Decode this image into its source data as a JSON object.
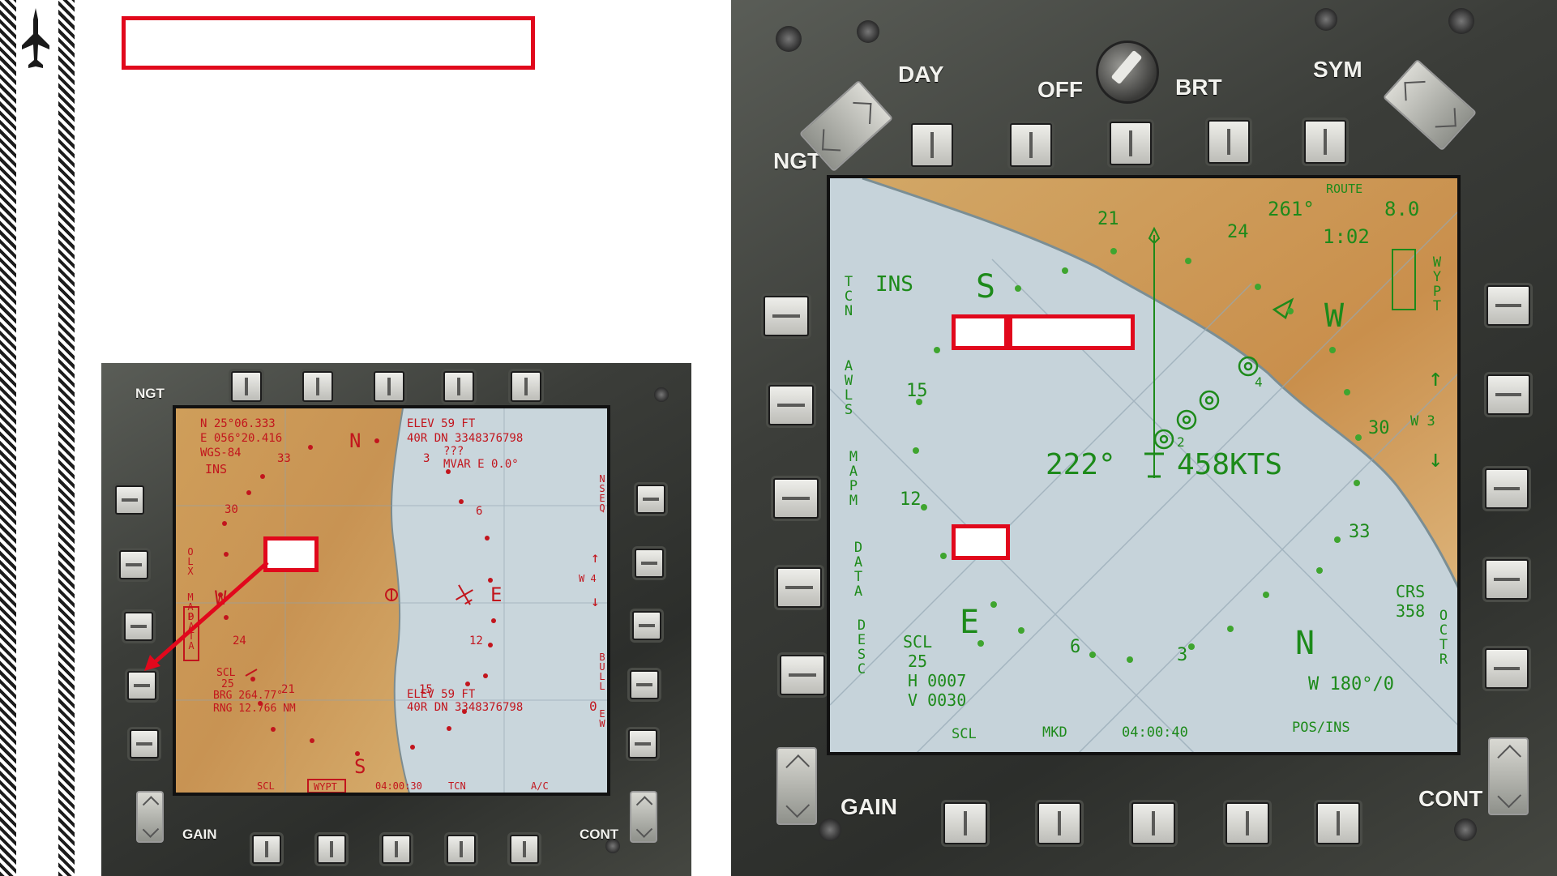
{
  "sidebar": {
    "aircraft_icon": "jet-icon"
  },
  "colors": {
    "callout": "#e1081c",
    "symbology_day": "#1d8a1a",
    "symbology_night": "#c2151d"
  },
  "left_mfd": {
    "bezel": {
      "ngt": "NGT",
      "gain": "GAIN",
      "cont": "CONT"
    },
    "top_left": {
      "lat": "N  25°06.333",
      "lon": "E 056°20.416",
      "datum": "WGS-84",
      "nav": "INS"
    },
    "top_right": {
      "elev": "ELEV      59 FT",
      "runway": "40R DN 3348376798",
      "unknown": "???",
      "mvar": "MVAR E 0.0°"
    },
    "left_labels": {
      "olx": "OLX",
      "map": "MAP",
      "data": "DATA"
    },
    "right_labels": {
      "nseq": "NSEQ",
      "w4": "W 4",
      "bull": "BULL",
      "ew": "EW"
    },
    "compass": {
      "n": "N",
      "e": "E",
      "s": "S",
      "w": "W"
    },
    "ring": [
      "33",
      "3",
      "6",
      "30",
      "12",
      "24",
      "21",
      "15"
    ],
    "bottom_left": {
      "scl": "SCL",
      "scale": "25",
      "brg": "BRG 264.77°",
      "rng": "RNG 12.766 NM"
    },
    "bottom_right": {
      "elev": "ELEV      59 FT",
      "runway": "40R DN 3348376798",
      "digit": "0"
    },
    "bottom_row": {
      "scl": "SCL",
      "wypt": "WYPT",
      "time": "04:00:30",
      "tcn": "TCN",
      "ac": "A/C"
    }
  },
  "right_mfd": {
    "bezel": {
      "day": "DAY",
      "off": "OFF",
      "brt": "BRT",
      "sym": "SYM",
      "ngt": "NGT",
      "gain": "GAIN",
      "cont": "CONT"
    },
    "top": {
      "route": "ROUTE",
      "heading": "261°",
      "dist": "8.0",
      "time": "1:02"
    },
    "left_labels": {
      "tcn": "TCN",
      "ins": "INS",
      "awls": "AWLS",
      "mapm": "MAPM",
      "data": "DATA",
      "desc": "DESC"
    },
    "right_labels": {
      "wypt": "WYPT",
      "w3": "W 3",
      "crs_label": "CRS",
      "crs": "358",
      "octr": "OCTR"
    },
    "center": {
      "track": "222°",
      "speed": "458KTS"
    },
    "compass": {
      "s": "S",
      "w": "W",
      "e": "E",
      "n": "N"
    },
    "ring": [
      "21",
      "24",
      "15",
      "30",
      "12",
      "33",
      "6",
      "3"
    ],
    "waypoints": [
      "2",
      "4"
    ],
    "bottom_left": {
      "scl": "SCL",
      "scale": "25",
      "h": "H 0007",
      "v": "V 0030"
    },
    "bottom_right": {
      "wind": "W 180°/0"
    },
    "bottom_row": {
      "scl": "SCL",
      "mkd": "MKD",
      "time": "04:00:40",
      "pos": "POS/INS"
    }
  }
}
